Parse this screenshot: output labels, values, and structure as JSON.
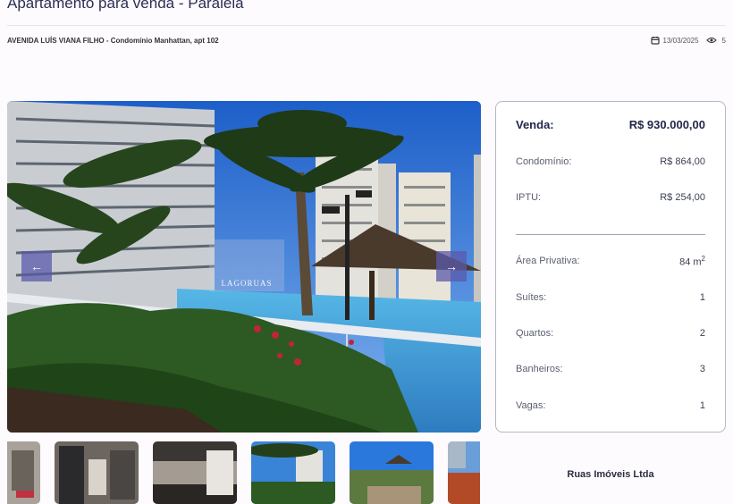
{
  "listing": {
    "title": "Apartamento para venda - Paralela",
    "address_street": "AVENIDA LUÍS VIANA FILHO",
    "address_detail": " - Condomínio Manhattan, apt 102",
    "date": "13/03/2025",
    "views": "5"
  },
  "gallery": {
    "prev_icon": "←",
    "next_icon": "→",
    "watermark_text": "LAGORUAS",
    "icons": {
      "prev": "arrow-left-icon",
      "next": "arrow-right-icon",
      "date": "calendar-icon",
      "views": "eye-icon"
    }
  },
  "pricing": {
    "sale_label": "Venda:",
    "sale_value": "R$ 930.000,00",
    "condo_label": "Condomínio:",
    "condo_value": "R$ 864,00",
    "iptu_label": "IPTU:",
    "iptu_value": "R$ 254,00"
  },
  "features": {
    "area_label": "Área Privativa:",
    "area_value": "84 m",
    "area_unit_sup": "2",
    "suites_label": "Suítes:",
    "suites_value": "1",
    "rooms_label": "Quartos:",
    "rooms_value": "2",
    "baths_label": "Banheiros:",
    "baths_value": "3",
    "parking_label": "Vagas:",
    "parking_value": "1"
  },
  "company": {
    "name": "Ruas Imóveis Ltda"
  },
  "colors": {
    "accent": "#23284a",
    "nav_button": "#5a5aaa",
    "card_border": "#b9b7c3"
  }
}
